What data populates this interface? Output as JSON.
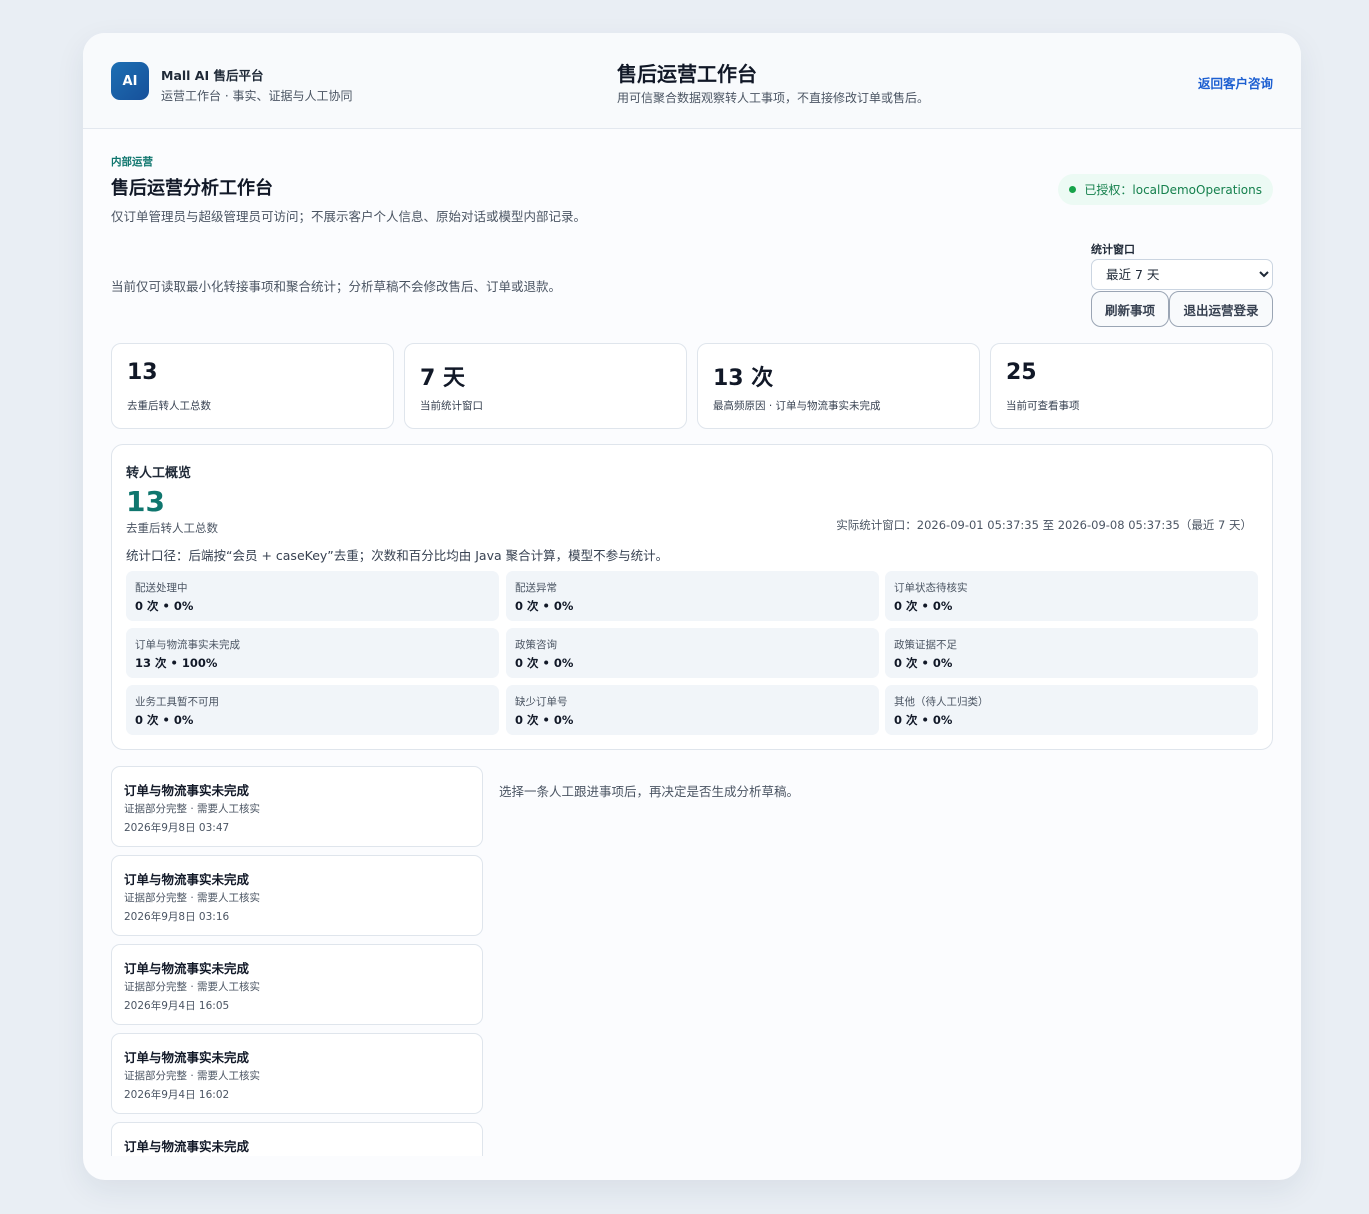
{
  "header": {
    "logo_text": "AI",
    "brand_name": "Mall AI 售后平台",
    "brand_sub": "运营工作台 · 事实、证据与人工协同",
    "title": "售后运营工作台",
    "subtitle": "用可信聚合数据观察转人工事项，不直接修改订单或售后。",
    "back_link": "返回客户咨询"
  },
  "page": {
    "eyebrow": "内部运营",
    "title": "售后运营分析工作台",
    "description": "仅订单管理员与超级管理员可访问；不展示客户个人信息、原始对话或模型内部记录。",
    "auth_badge": "已授权：localDemoOperations",
    "notice": "当前仅可读取最小化转接事项和聚合统计；分析草稿不会修改售后、订单或退款。"
  },
  "controls": {
    "window_label": "统计窗口",
    "window_selected": "最近 7 天",
    "refresh_button": "刷新事项",
    "logout_button": "退出运营登录"
  },
  "stats": [
    {
      "value": "13",
      "label": "去重后转人工总数"
    },
    {
      "value": "7 天",
      "label": "当前统计窗口"
    },
    {
      "value": "13 次",
      "label": "最高频原因 · 订单与物流事实未完成"
    },
    {
      "value": "25",
      "label": "当前可查看事项"
    }
  ],
  "overview": {
    "title": "转人工概览",
    "total": "13",
    "total_label": "去重后转人工总数",
    "window_text": "实际统计窗口：2026-09-01 05:37:35 至 2026-09-08 05:37:35（最近 7 天）",
    "note": "统计口径：后端按“会员 + caseKey”去重；次数和百分比均由 Java 聚合计算，模型不参与统计。",
    "reasons": [
      {
        "name": "配送处理中",
        "value": "0 次 • 0%"
      },
      {
        "name": "配送异常",
        "value": "0 次 • 0%"
      },
      {
        "name": "订单状态待核实",
        "value": "0 次 • 0%"
      },
      {
        "name": "订单与物流事实未完成",
        "value": "13 次 • 100%"
      },
      {
        "name": "政策咨询",
        "value": "0 次 • 0%"
      },
      {
        "name": "政策证据不足",
        "value": "0 次 • 0%"
      },
      {
        "name": "业务工具暂不可用",
        "value": "0 次 • 0%"
      },
      {
        "name": "缺少订单号",
        "value": "0 次 • 0%"
      },
      {
        "name": "其他（待人工归类）",
        "value": "0 次 • 0%"
      }
    ]
  },
  "cases": [
    {
      "title": "订单与物流事实未完成",
      "status": "证据部分完整 · 需要人工核实",
      "time": "2026年9月8日 03:47"
    },
    {
      "title": "订单与物流事实未完成",
      "status": "证据部分完整 · 需要人工核实",
      "time": "2026年9月8日 03:16"
    },
    {
      "title": "订单与物流事实未完成",
      "status": "证据部分完整 · 需要人工核实",
      "time": "2026年9月4日 16:05"
    },
    {
      "title": "订单与物流事实未完成",
      "status": "证据部分完整 · 需要人工核实",
      "time": "2026年9月4日 16:02"
    },
    {
      "title": "订单与物流事实未完成",
      "status": "",
      "time": ""
    }
  ],
  "detail_hint": "选择一条人工跟进事项后，再决定是否生成分析草稿。"
}
